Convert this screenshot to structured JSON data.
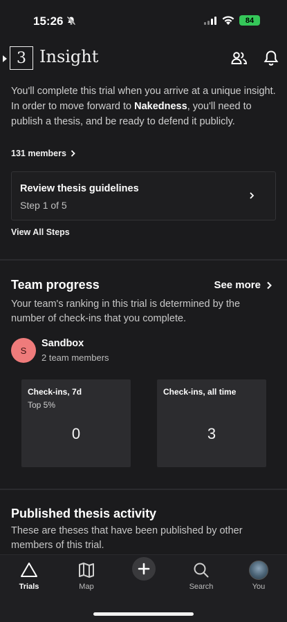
{
  "status_bar": {
    "time": "15:26",
    "battery": "84"
  },
  "header": {
    "logo_glyph": "3",
    "title": "Insight",
    "icons": [
      "people-icon",
      "bell-icon"
    ]
  },
  "intro": {
    "part1": "You'll complete this trial when you arrive at a unique insight. In order to move forward to ",
    "highlight": "Nakedness",
    "part2": ", you'll need to publish a thesis, and be ready to defend it publicly."
  },
  "members_link": "131 members",
  "step_card": {
    "title": "Review thesis guidelines",
    "subtitle": "Step 1 of 5"
  },
  "view_all_steps": "View All Steps",
  "team_progress": {
    "title": "Team progress",
    "see_more": "See more",
    "description": "Your team's ranking in this trial is determined by the number of check-ins that you complete.",
    "team": {
      "initial": "S",
      "name": "Sandbox",
      "members": "2 team members"
    },
    "stats": [
      {
        "label": "Check-ins, 7d",
        "sub": "Top 5%",
        "value": "0"
      },
      {
        "label": "Check-ins, all time",
        "sub": "",
        "value": "3"
      }
    ]
  },
  "published_activity": {
    "title": "Published thesis activity",
    "description": "These are theses that have been published by other members of this trial."
  },
  "tabbar": {
    "trials": "Trials",
    "map": "Map",
    "search": "Search",
    "you": "You",
    "active": "trials"
  },
  "colors": {
    "background": "#1b1b1d",
    "battery": "#35c759",
    "team_avatar": "#ef7b7b"
  }
}
